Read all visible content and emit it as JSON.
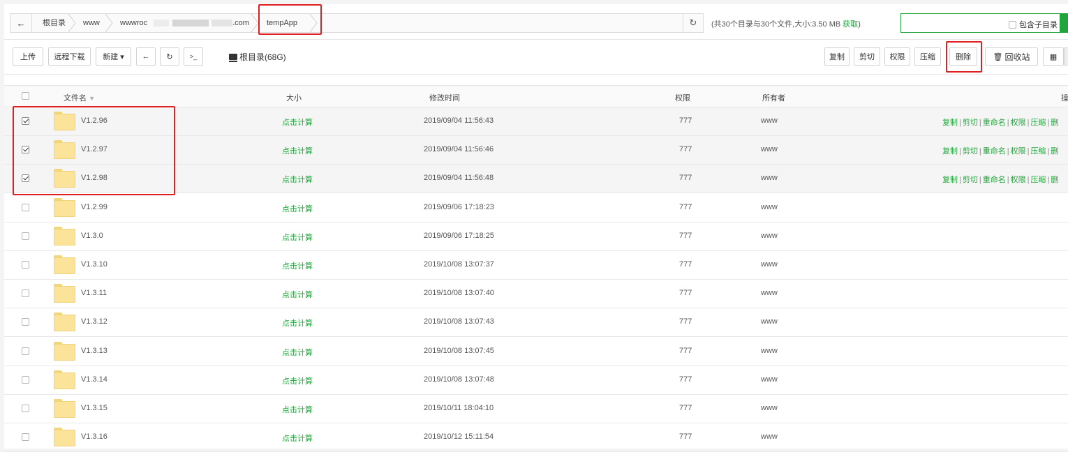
{
  "path": {
    "crumbs": [
      "根目录",
      "www",
      "wwwroc",
      ".com",
      "tempApp"
    ]
  },
  "summary": {
    "text": "(共30个目录与30个文件,大小:3.50 MB",
    "fetch_link": "获取",
    "close": ")"
  },
  "search": {
    "include_subdir_label": "包含子目录"
  },
  "toolbar": {
    "upload": "上传",
    "remote_download": "远程下载",
    "new": "新建",
    "new_caret": "▾",
    "back_icon": "←",
    "refresh_icon": "↻",
    "terminal_icon": ">_",
    "disk_label": "根目录(68G)",
    "copy": "复制",
    "cut": "剪切",
    "permission": "权限",
    "compress": "压缩",
    "delete": "删除",
    "recycle_bin": "回收站",
    "recycle_icon": "🗑",
    "grid_icon": "▦"
  },
  "table": {
    "headers": {
      "name": "文件名",
      "sort": "▼",
      "size": "大小",
      "mtime": "修改时间",
      "perm": "权限",
      "owner": "所有者",
      "ops": "操"
    },
    "row_ops": [
      "复制",
      "剪切",
      "重命名",
      "权限",
      "压缩",
      "删"
    ],
    "rows": [
      {
        "name": "V1.2.96",
        "size": "点击计算",
        "mtime": "2019/09/04 11:56:43",
        "perm": "777",
        "owner": "www",
        "checked": true
      },
      {
        "name": "V1.2.97",
        "size": "点击计算",
        "mtime": "2019/09/04 11:56:46",
        "perm": "777",
        "owner": "www",
        "checked": true
      },
      {
        "name": "V1.2.98",
        "size": "点击计算",
        "mtime": "2019/09/04 11:56:48",
        "perm": "777",
        "owner": "www",
        "checked": true
      },
      {
        "name": "V1.2.99",
        "size": "点击计算",
        "mtime": "2019/09/06 17:18:23",
        "perm": "777",
        "owner": "www",
        "checked": false
      },
      {
        "name": "V1.3.0",
        "size": "点击计算",
        "mtime": "2019/09/06 17:18:25",
        "perm": "777",
        "owner": "www",
        "checked": false
      },
      {
        "name": "V1.3.10",
        "size": "点击计算",
        "mtime": "2019/10/08 13:07:37",
        "perm": "777",
        "owner": "www",
        "checked": false
      },
      {
        "name": "V1.3.11",
        "size": "点击计算",
        "mtime": "2019/10/08 13:07:40",
        "perm": "777",
        "owner": "www",
        "checked": false
      },
      {
        "name": "V1.3.12",
        "size": "点击计算",
        "mtime": "2019/10/08 13:07:43",
        "perm": "777",
        "owner": "www",
        "checked": false
      },
      {
        "name": "V1.3.13",
        "size": "点击计算",
        "mtime": "2019/10/08 13:07:45",
        "perm": "777",
        "owner": "www",
        "checked": false
      },
      {
        "name": "V1.3.14",
        "size": "点击计算",
        "mtime": "2019/10/08 13:07:48",
        "perm": "777",
        "owner": "www",
        "checked": false
      },
      {
        "name": "V1.3.15",
        "size": "点击计算",
        "mtime": "2019/10/11 18:04:10",
        "perm": "777",
        "owner": "www",
        "checked": false
      },
      {
        "name": "V1.3.16",
        "size": "点击计算",
        "mtime": "2019/10/12 15:11:54",
        "perm": "777",
        "owner": "www",
        "checked": false
      }
    ]
  },
  "colors": {
    "accent": "#20a53a",
    "highlight_box": "#e02020",
    "folder": "#fbe39a"
  }
}
